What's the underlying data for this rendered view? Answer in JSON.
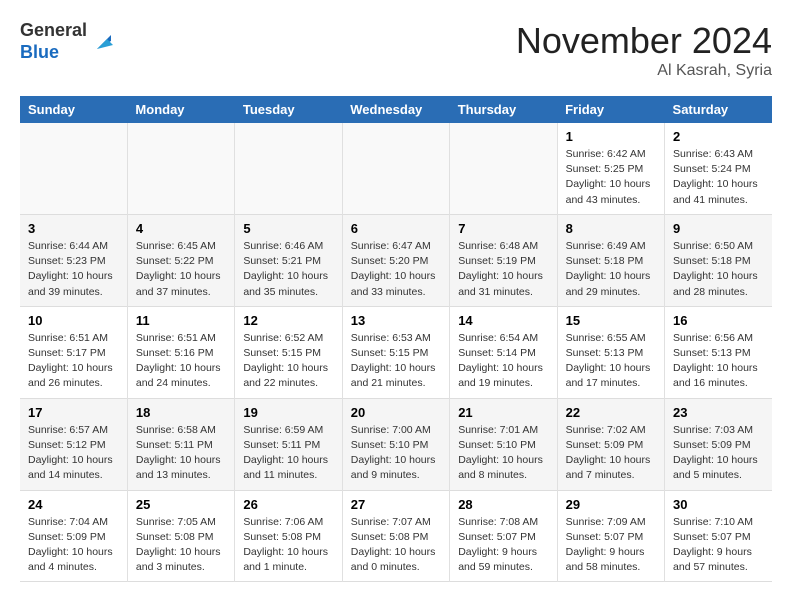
{
  "logo": {
    "line1": "General",
    "line2": "Blue"
  },
  "title": "November 2024",
  "location": "Al Kasrah, Syria",
  "days_of_week": [
    "Sunday",
    "Monday",
    "Tuesday",
    "Wednesday",
    "Thursday",
    "Friday",
    "Saturday"
  ],
  "weeks": [
    [
      {
        "day": "",
        "info": ""
      },
      {
        "day": "",
        "info": ""
      },
      {
        "day": "",
        "info": ""
      },
      {
        "day": "",
        "info": ""
      },
      {
        "day": "",
        "info": ""
      },
      {
        "day": "1",
        "info": "Sunrise: 6:42 AM\nSunset: 5:25 PM\nDaylight: 10 hours and 43 minutes."
      },
      {
        "day": "2",
        "info": "Sunrise: 6:43 AM\nSunset: 5:24 PM\nDaylight: 10 hours and 41 minutes."
      }
    ],
    [
      {
        "day": "3",
        "info": "Sunrise: 6:44 AM\nSunset: 5:23 PM\nDaylight: 10 hours and 39 minutes."
      },
      {
        "day": "4",
        "info": "Sunrise: 6:45 AM\nSunset: 5:22 PM\nDaylight: 10 hours and 37 minutes."
      },
      {
        "day": "5",
        "info": "Sunrise: 6:46 AM\nSunset: 5:21 PM\nDaylight: 10 hours and 35 minutes."
      },
      {
        "day": "6",
        "info": "Sunrise: 6:47 AM\nSunset: 5:20 PM\nDaylight: 10 hours and 33 minutes."
      },
      {
        "day": "7",
        "info": "Sunrise: 6:48 AM\nSunset: 5:19 PM\nDaylight: 10 hours and 31 minutes."
      },
      {
        "day": "8",
        "info": "Sunrise: 6:49 AM\nSunset: 5:18 PM\nDaylight: 10 hours and 29 minutes."
      },
      {
        "day": "9",
        "info": "Sunrise: 6:50 AM\nSunset: 5:18 PM\nDaylight: 10 hours and 28 minutes."
      }
    ],
    [
      {
        "day": "10",
        "info": "Sunrise: 6:51 AM\nSunset: 5:17 PM\nDaylight: 10 hours and 26 minutes."
      },
      {
        "day": "11",
        "info": "Sunrise: 6:51 AM\nSunset: 5:16 PM\nDaylight: 10 hours and 24 minutes."
      },
      {
        "day": "12",
        "info": "Sunrise: 6:52 AM\nSunset: 5:15 PM\nDaylight: 10 hours and 22 minutes."
      },
      {
        "day": "13",
        "info": "Sunrise: 6:53 AM\nSunset: 5:15 PM\nDaylight: 10 hours and 21 minutes."
      },
      {
        "day": "14",
        "info": "Sunrise: 6:54 AM\nSunset: 5:14 PM\nDaylight: 10 hours and 19 minutes."
      },
      {
        "day": "15",
        "info": "Sunrise: 6:55 AM\nSunset: 5:13 PM\nDaylight: 10 hours and 17 minutes."
      },
      {
        "day": "16",
        "info": "Sunrise: 6:56 AM\nSunset: 5:13 PM\nDaylight: 10 hours and 16 minutes."
      }
    ],
    [
      {
        "day": "17",
        "info": "Sunrise: 6:57 AM\nSunset: 5:12 PM\nDaylight: 10 hours and 14 minutes."
      },
      {
        "day": "18",
        "info": "Sunrise: 6:58 AM\nSunset: 5:11 PM\nDaylight: 10 hours and 13 minutes."
      },
      {
        "day": "19",
        "info": "Sunrise: 6:59 AM\nSunset: 5:11 PM\nDaylight: 10 hours and 11 minutes."
      },
      {
        "day": "20",
        "info": "Sunrise: 7:00 AM\nSunset: 5:10 PM\nDaylight: 10 hours and 9 minutes."
      },
      {
        "day": "21",
        "info": "Sunrise: 7:01 AM\nSunset: 5:10 PM\nDaylight: 10 hours and 8 minutes."
      },
      {
        "day": "22",
        "info": "Sunrise: 7:02 AM\nSunset: 5:09 PM\nDaylight: 10 hours and 7 minutes."
      },
      {
        "day": "23",
        "info": "Sunrise: 7:03 AM\nSunset: 5:09 PM\nDaylight: 10 hours and 5 minutes."
      }
    ],
    [
      {
        "day": "24",
        "info": "Sunrise: 7:04 AM\nSunset: 5:09 PM\nDaylight: 10 hours and 4 minutes."
      },
      {
        "day": "25",
        "info": "Sunrise: 7:05 AM\nSunset: 5:08 PM\nDaylight: 10 hours and 3 minutes."
      },
      {
        "day": "26",
        "info": "Sunrise: 7:06 AM\nSunset: 5:08 PM\nDaylight: 10 hours and 1 minute."
      },
      {
        "day": "27",
        "info": "Sunrise: 7:07 AM\nSunset: 5:08 PM\nDaylight: 10 hours and 0 minutes."
      },
      {
        "day": "28",
        "info": "Sunrise: 7:08 AM\nSunset: 5:07 PM\nDaylight: 9 hours and 59 minutes."
      },
      {
        "day": "29",
        "info": "Sunrise: 7:09 AM\nSunset: 5:07 PM\nDaylight: 9 hours and 58 minutes."
      },
      {
        "day": "30",
        "info": "Sunrise: 7:10 AM\nSunset: 5:07 PM\nDaylight: 9 hours and 57 minutes."
      }
    ]
  ]
}
